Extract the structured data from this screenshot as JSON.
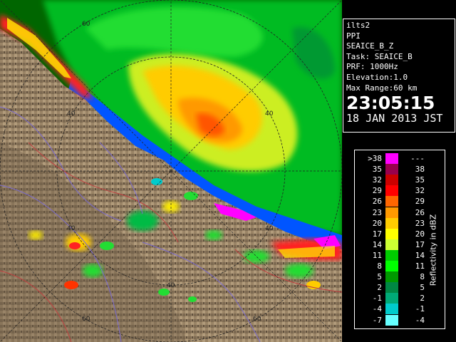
{
  "info": {
    "radar": "ilts2",
    "mode": "PPI",
    "product": "SEAICE_B_Z",
    "task": "Task: SEAICE_B",
    "prf": "PRF: 1000Hz",
    "elevation": "Elevation:1.0",
    "max_range": "Max Range:60 km",
    "time": "23:05:15",
    "date": "18 JAN 2013 JST"
  },
  "legend": {
    "title": "Reflectivity in dBZ",
    "rows": [
      {
        "lo": ">38",
        "hi": "---",
        "color": "#ff00ff"
      },
      {
        "lo": "35",
        "hi": "38",
        "color": "#99004d"
      },
      {
        "lo": "32",
        "hi": "35",
        "color": "#cc0000"
      },
      {
        "lo": "29",
        "hi": "32",
        "color": "#ff0000"
      },
      {
        "lo": "26",
        "hi": "29",
        "color": "#ff6600"
      },
      {
        "lo": "23",
        "hi": "26",
        "color": "#ff9900"
      },
      {
        "lo": "20",
        "hi": "23",
        "color": "#ffcc00"
      },
      {
        "lo": "17",
        "hi": "20",
        "color": "#ffff00"
      },
      {
        "lo": "14",
        "hi": "17",
        "color": "#ccff33"
      },
      {
        "lo": "11",
        "hi": "14",
        "color": "#00cc00"
      },
      {
        "lo": "8",
        "hi": "11",
        "color": "#00ff00"
      },
      {
        "lo": "5",
        "hi": "8",
        "color": "#009900"
      },
      {
        "lo": "2",
        "hi": "5",
        "color": "#008844"
      },
      {
        "lo": "-1",
        "hi": "2",
        "color": "#00aa77"
      },
      {
        "lo": "-4",
        "hi": "-1",
        "color": "#00cccc"
      },
      {
        "lo": "-7",
        "hi": "-4",
        "color": "#66ffff"
      }
    ]
  },
  "range_rings": {
    "labels": [
      "60",
      "40",
      "40",
      "40",
      "40",
      "40",
      "60",
      "60"
    ]
  }
}
